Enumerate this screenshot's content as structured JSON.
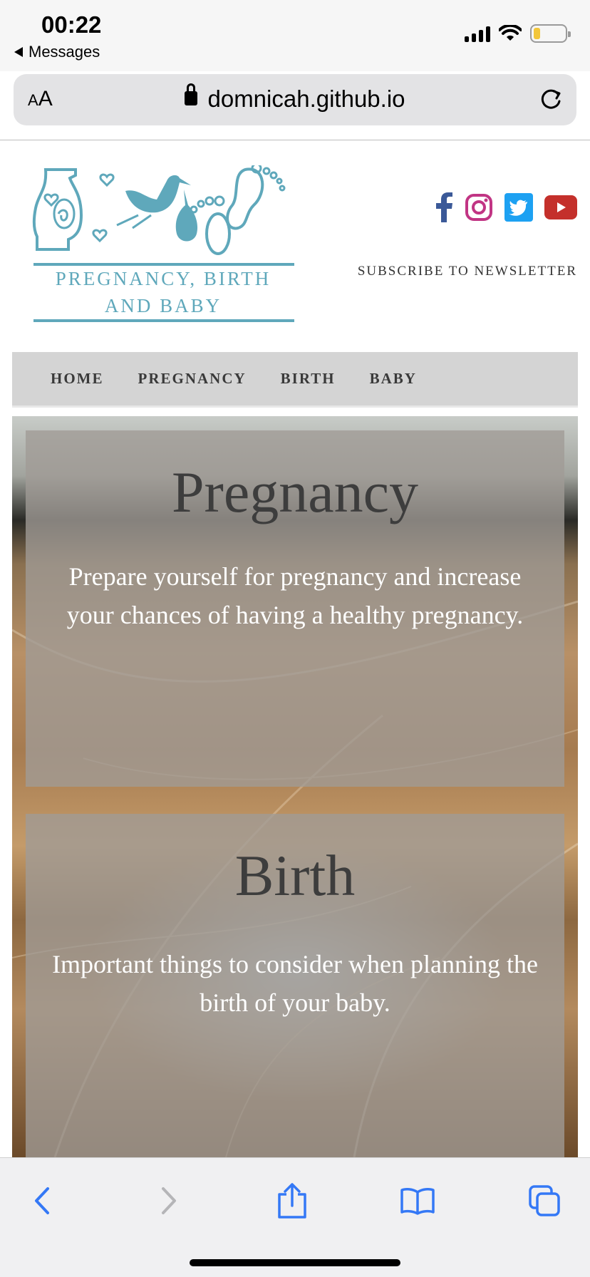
{
  "status_bar": {
    "time": "00:22",
    "back_app_label": "Messages",
    "battery_level_percent": 20
  },
  "browser": {
    "text_size_label_small": "A",
    "text_size_label_large": "A",
    "url": "domnicah.github.io"
  },
  "header": {
    "logo_text_line1": "PREGNANCY, BIRTH",
    "logo_text_line2": "AND BABY",
    "logo_color": "#5fa8bb",
    "socials": [
      {
        "name": "facebook-icon",
        "color": "#3b5998"
      },
      {
        "name": "instagram-icon",
        "color": "#c13584"
      },
      {
        "name": "twitter-icon",
        "color": "#1da1f2"
      },
      {
        "name": "youtube-icon",
        "color": "#c4302b"
      }
    ],
    "subscribe_label": "SUBSCRIBE TO NEWSLETTER"
  },
  "nav": {
    "items": [
      "HOME",
      "PREGNANCY",
      "BIRTH",
      "BABY"
    ]
  },
  "cards": [
    {
      "title": "Pregnancy",
      "text": "Prepare yourself for pregnancy and increase your chances of having a healthy pregnancy."
    },
    {
      "title": "Birth",
      "text": "Important things to consider when planning the birth of your baby."
    }
  ],
  "toolbar": {
    "icons": [
      "back-icon",
      "forward-icon",
      "share-icon",
      "bookmarks-icon",
      "tabs-icon"
    ],
    "accent_color": "#3478f6",
    "disabled_color": "#b5b5b8"
  }
}
